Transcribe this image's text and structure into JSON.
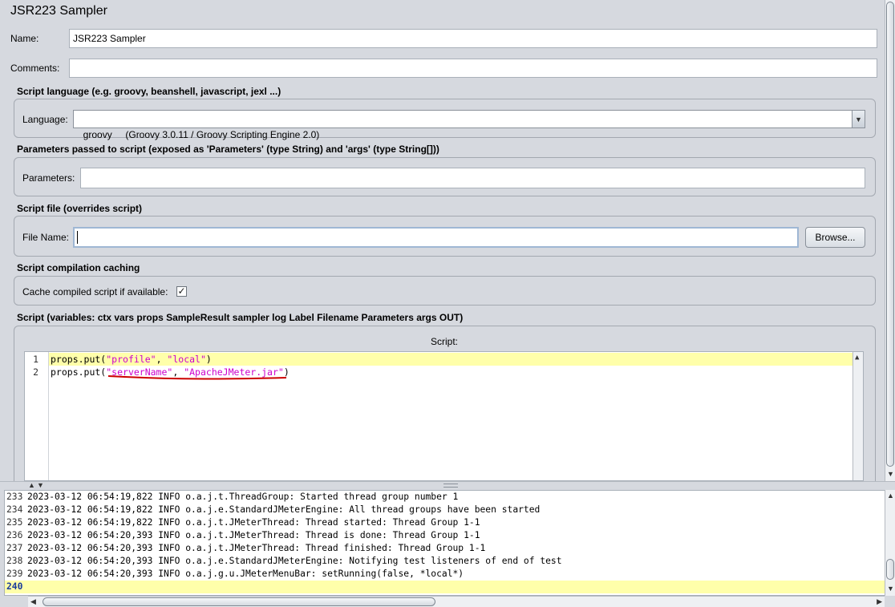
{
  "window": {
    "title": "JSR223 Sampler"
  },
  "form": {
    "name_label": "Name:",
    "name_value": "JSR223 Sampler",
    "comments_label": "Comments:",
    "comments_value": ""
  },
  "language_section": {
    "title": "Script language (e.g. groovy, beanshell, javascript, jexl ...)",
    "label": "Language:",
    "selected": "groovy     (Groovy 3.0.11 / Groovy Scripting Engine 2.0)",
    "dropdown_icon": "triangle-down"
  },
  "parameters_section": {
    "title": "Parameters passed to script (exposed as 'Parameters' (type String) and 'args' (type String[]))",
    "label": "Parameters:",
    "value": ""
  },
  "file_section": {
    "title": "Script file (overrides script)",
    "label": "File Name:",
    "value": "",
    "browse_label": "Browse..."
  },
  "caching_section": {
    "title": "Script compilation caching",
    "label": "Cache compiled script if available:",
    "checked": true
  },
  "script_section": {
    "title": "Script (variables: ctx vars props SampleResult sampler log Label Filename Parameters args OUT)",
    "editor_label": "Script:",
    "lines": [
      {
        "num": "1",
        "prefix": "props.put(",
        "arg1": "\"profile\"",
        "sep": ", ",
        "arg2": "\"local\"",
        "suffix": ")"
      },
      {
        "num": "2",
        "prefix": "props.put(",
        "arg1": "\"serverName\"",
        "sep": ", ",
        "arg2": "\"ApacheJMeter.jar\"",
        "suffix": ")"
      }
    ],
    "underline_color": "#cc0000"
  },
  "log": {
    "rows": [
      {
        "num": "233",
        "text": "2023-03-12 06:54:19,822 INFO o.a.j.t.ThreadGroup: Started thread group number 1"
      },
      {
        "num": "234",
        "text": "2023-03-12 06:54:19,822 INFO o.a.j.e.StandardJMeterEngine: All thread groups have been started"
      },
      {
        "num": "235",
        "text": "2023-03-12 06:54:19,822 INFO o.a.j.t.JMeterThread: Thread started: Thread Group 1-1"
      },
      {
        "num": "236",
        "text": "2023-03-12 06:54:20,393 INFO o.a.j.t.JMeterThread: Thread is done: Thread Group 1-1"
      },
      {
        "num": "237",
        "text": "2023-03-12 06:54:20,393 INFO o.a.j.t.JMeterThread: Thread finished: Thread Group 1-1"
      },
      {
        "num": "238",
        "text": "2023-03-12 06:54:20,393 INFO o.a.j.e.StandardJMeterEngine: Notifying test listeners of end of test"
      },
      {
        "num": "239",
        "text": "2023-03-12 06:54:20,393 INFO o.a.j.g.u.JMeterMenuBar: setRunning(false, *local*)"
      },
      {
        "num": "240",
        "text": ""
      }
    ]
  },
  "colors": {
    "background": "#d6d9df",
    "current_line": "#ffffaa",
    "string_literal": "#cc00cc"
  }
}
